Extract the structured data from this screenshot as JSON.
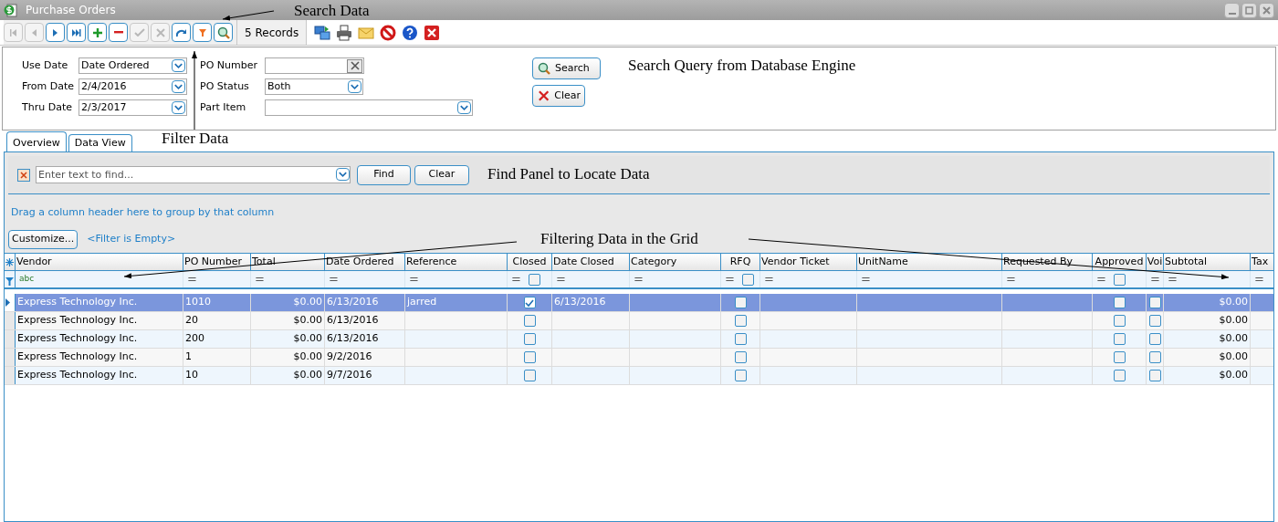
{
  "window": {
    "title": "Purchase Orders"
  },
  "toolbar": {
    "buttons": [
      {
        "kind": "first",
        "disabled": true
      },
      {
        "kind": "prev",
        "disabled": true
      },
      {
        "kind": "next",
        "disabled": false
      },
      {
        "kind": "last",
        "disabled": false
      },
      {
        "kind": "add",
        "disabled": false
      },
      {
        "kind": "remove",
        "disabled": false
      },
      {
        "kind": "accept",
        "disabled": true
      },
      {
        "kind": "cancel",
        "disabled": true
      },
      {
        "kind": "refresh",
        "disabled": false
      },
      {
        "kind": "filter",
        "disabled": false
      },
      {
        "kind": "search",
        "disabled": false
      }
    ],
    "record_count": "5 Records",
    "actions": [
      {
        "kind": "export"
      },
      {
        "kind": "print"
      },
      {
        "kind": "email"
      },
      {
        "kind": "stop"
      },
      {
        "kind": "help"
      },
      {
        "kind": "close"
      }
    ]
  },
  "search_panel": {
    "fields": [
      {
        "label": "Use Date",
        "value": "Date Ordered",
        "kind": "combo"
      },
      {
        "label": "From Date",
        "value": "2/4/2016",
        "kind": "combo"
      },
      {
        "label": "Thru Date",
        "value": "2/3/2017",
        "kind": "combo"
      },
      {
        "label": "PO Number",
        "kind": "clear"
      },
      {
        "label": "PO Status",
        "value": "Both",
        "kind": "combo"
      },
      {
        "label": "Part Item",
        "kind": "combo"
      }
    ],
    "search_button": "Search",
    "clear_button": "Clear"
  },
  "tabs": [
    {
      "label": "Overview",
      "selected": true
    },
    {
      "label": "Data View",
      "selected": false
    }
  ],
  "find_panel": {
    "placeholder": "Enter text to find...",
    "find_button": "Find",
    "clear_button": "Clear"
  },
  "group_hint": "Drag a column header here to group by that column",
  "customize_button": "Customize...",
  "filter_status": "<Filter is Empty>",
  "grid": {
    "columns": [
      {
        "label": "Vendor",
        "kind": "text",
        "filter": "abc"
      },
      {
        "label": "PO Number",
        "kind": "text",
        "filter": "="
      },
      {
        "label": "Total",
        "kind": "money",
        "filter": "="
      },
      {
        "label": "Date Ordered",
        "kind": "text",
        "filter": "="
      },
      {
        "label": "Reference",
        "kind": "text",
        "filter": "="
      },
      {
        "label": "Closed",
        "kind": "check",
        "filter": "=",
        "filter_checked": false
      },
      {
        "label": "Date Closed",
        "kind": "text",
        "filter": "="
      },
      {
        "label": "Category",
        "kind": "text",
        "filter": "="
      },
      {
        "label": "RFQ",
        "kind": "check",
        "filter": "=",
        "filter_checked": false
      },
      {
        "label": "Vendor Ticket",
        "kind": "text",
        "filter": "="
      },
      {
        "label": "UnitName",
        "kind": "text",
        "filter": "="
      },
      {
        "label": "Requested By",
        "kind": "text",
        "filter": "="
      },
      {
        "label": "Approved",
        "kind": "check",
        "filter": "=",
        "filter_checked": false
      },
      {
        "label": "Voi",
        "kind": "check",
        "filter": "="
      },
      {
        "label": "Subtotal",
        "kind": "money",
        "filter": "="
      },
      {
        "label": "Tax",
        "kind": "text",
        "filter": "="
      }
    ],
    "rows": [
      {
        "selected": true,
        "cells": [
          "Express Technology Inc.",
          "1010",
          "$0.00",
          "6/13/2016",
          "jarred",
          true,
          "6/13/2016",
          "",
          false,
          "",
          "",
          "",
          false,
          false,
          "$0.00",
          ""
        ]
      },
      {
        "selected": false,
        "cells": [
          "Express Technology Inc.",
          "20",
          "$0.00",
          "6/13/2016",
          "",
          false,
          "",
          "",
          false,
          "",
          "",
          "",
          false,
          false,
          "$0.00",
          ""
        ]
      },
      {
        "selected": false,
        "cells": [
          "Express Technology Inc.",
          "200",
          "$0.00",
          "6/13/2016",
          "",
          false,
          "",
          "",
          false,
          "",
          "",
          "",
          false,
          false,
          "$0.00",
          ""
        ]
      },
      {
        "selected": false,
        "cells": [
          "Express Technology Inc.",
          "1",
          "$0.00",
          "9/2/2016",
          "",
          false,
          "",
          "",
          false,
          "",
          "",
          "",
          false,
          false,
          "$0.00",
          ""
        ]
      },
      {
        "selected": false,
        "cells": [
          "Express Technology Inc.",
          "10",
          "$0.00",
          "9/7/2016",
          "",
          false,
          "",
          "",
          false,
          "",
          "",
          "",
          false,
          false,
          "$0.00",
          ""
        ]
      }
    ]
  },
  "annotations": [
    "Search Data",
    "Filter Data",
    "Search Query from Database Engine",
    "Find Panel to Locate Data",
    "Filtering Data in the Grid"
  ]
}
